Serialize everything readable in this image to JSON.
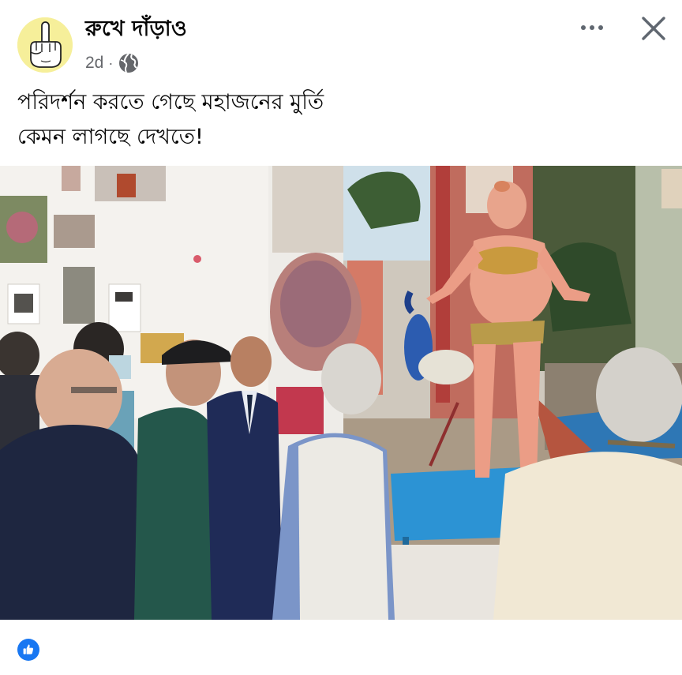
{
  "post": {
    "author": "রুখে দাঁড়াও",
    "time": "2d",
    "separator": "·",
    "privacy_icon": "globe-icon",
    "avatar_icon": "middle-finger-hand-icon",
    "caption_line1": "পরিদর্শন করতে গেছে মহাজনের মুর্তি",
    "caption_line2": "কেমন লাগছে দেখতে!"
  },
  "actions": {
    "more_icon": "more-horizontal-icon",
    "close_icon": "close-icon"
  },
  "reactions": {
    "icon": "like-thumbs-up-icon",
    "color": "#1877f2"
  },
  "colors": {
    "text_primary": "#050505",
    "text_secondary": "#65676b",
    "facebook_blue": "#1877f2"
  }
}
